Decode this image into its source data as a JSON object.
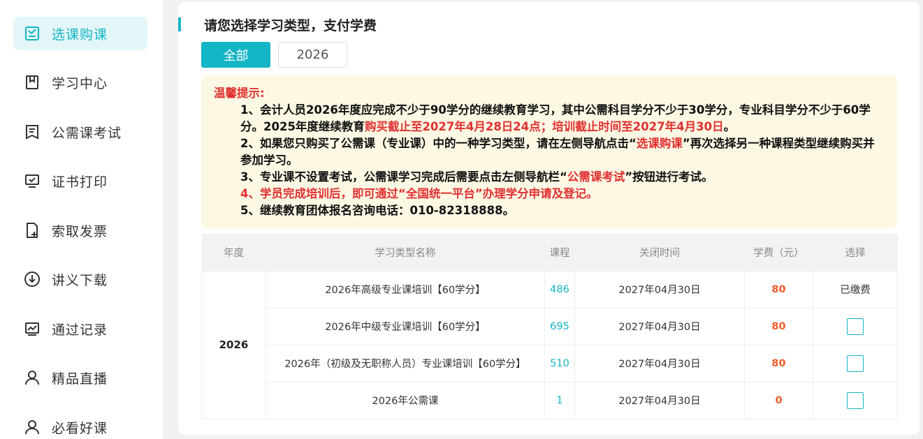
{
  "sidebar": {
    "items": [
      {
        "label": "选课购课",
        "icon": "checklist-icon",
        "active": true
      },
      {
        "label": "学习中心",
        "icon": "book-icon"
      },
      {
        "label": "公需课考试",
        "icon": "exam-icon"
      },
      {
        "label": "证书打印",
        "icon": "certificate-icon"
      },
      {
        "label": "索取发票",
        "icon": "invoice-icon"
      },
      {
        "label": "讲义下载",
        "icon": "download-icon"
      },
      {
        "label": "通过记录",
        "icon": "chart-icon"
      },
      {
        "label": "精品直播",
        "icon": "user-icon"
      },
      {
        "label": "必看好课",
        "icon": "user-icon"
      }
    ]
  },
  "main": {
    "title": "请您选择学习类型，支付学费",
    "tabs": [
      {
        "label": "全部",
        "active": true
      },
      {
        "label": "2026",
        "active": false
      }
    ]
  },
  "notice": {
    "title": "温馨提示:",
    "line1a": "1、会计人员2026年度应完成不少于90学分的继续教育学习，其中公需科目学分不少于30学分，专业科目学分不少于60学分。2025年度继续教育",
    "line1b": "购买截止至2027年4月28日24点；培训截止时间至2027年4月30日",
    "line1c": "。",
    "line2a": "2、如果您只购买了公需课（专业课）中的一种学习类型，请在左侧导航点击“",
    "line2b": "选课购课",
    "line2c": "”再次选择另一种课程类型继续购买并参加学习。",
    "line3a": "3、专业课不设置考试，公需课学习完成后需要点击左侧导航栏“",
    "line3b": "公需课考试",
    "line3c": "”按钮进行考试。",
    "line4": "4、学员完成培训后，即可通过“全国统一平台”办理学分申请及登记。",
    "line5": "5、继续教育团体报名咨询电话：010-82318888。"
  },
  "table": {
    "headers": [
      "年度",
      "学习类型名称",
      "课程",
      "关闭时间",
      "学费（元）",
      "选择"
    ],
    "year": "2026",
    "rows": [
      {
        "name": "2026年高级专业课培训【60学分】",
        "count": "486",
        "close": "2027年04月30日",
        "fee": "80",
        "select": "已缴费"
      },
      {
        "name": "2026年中级专业课培训【60学分】",
        "count": "695",
        "close": "2027年04月30日",
        "fee": "80",
        "select": ""
      },
      {
        "name": "2026年（初级及无职称人员）专业课培训【60学分】",
        "count": "510",
        "close": "2027年04月30日",
        "fee": "80",
        "select": ""
      },
      {
        "name": "2026年公需课",
        "count": "1",
        "close": "2027年04月30日",
        "fee": "0",
        "select": ""
      }
    ]
  },
  "colors": {
    "accent": "#14b5c4",
    "warning": "#e03131",
    "fee": "#f05a28",
    "notice_bg": "#fdf8e4"
  }
}
